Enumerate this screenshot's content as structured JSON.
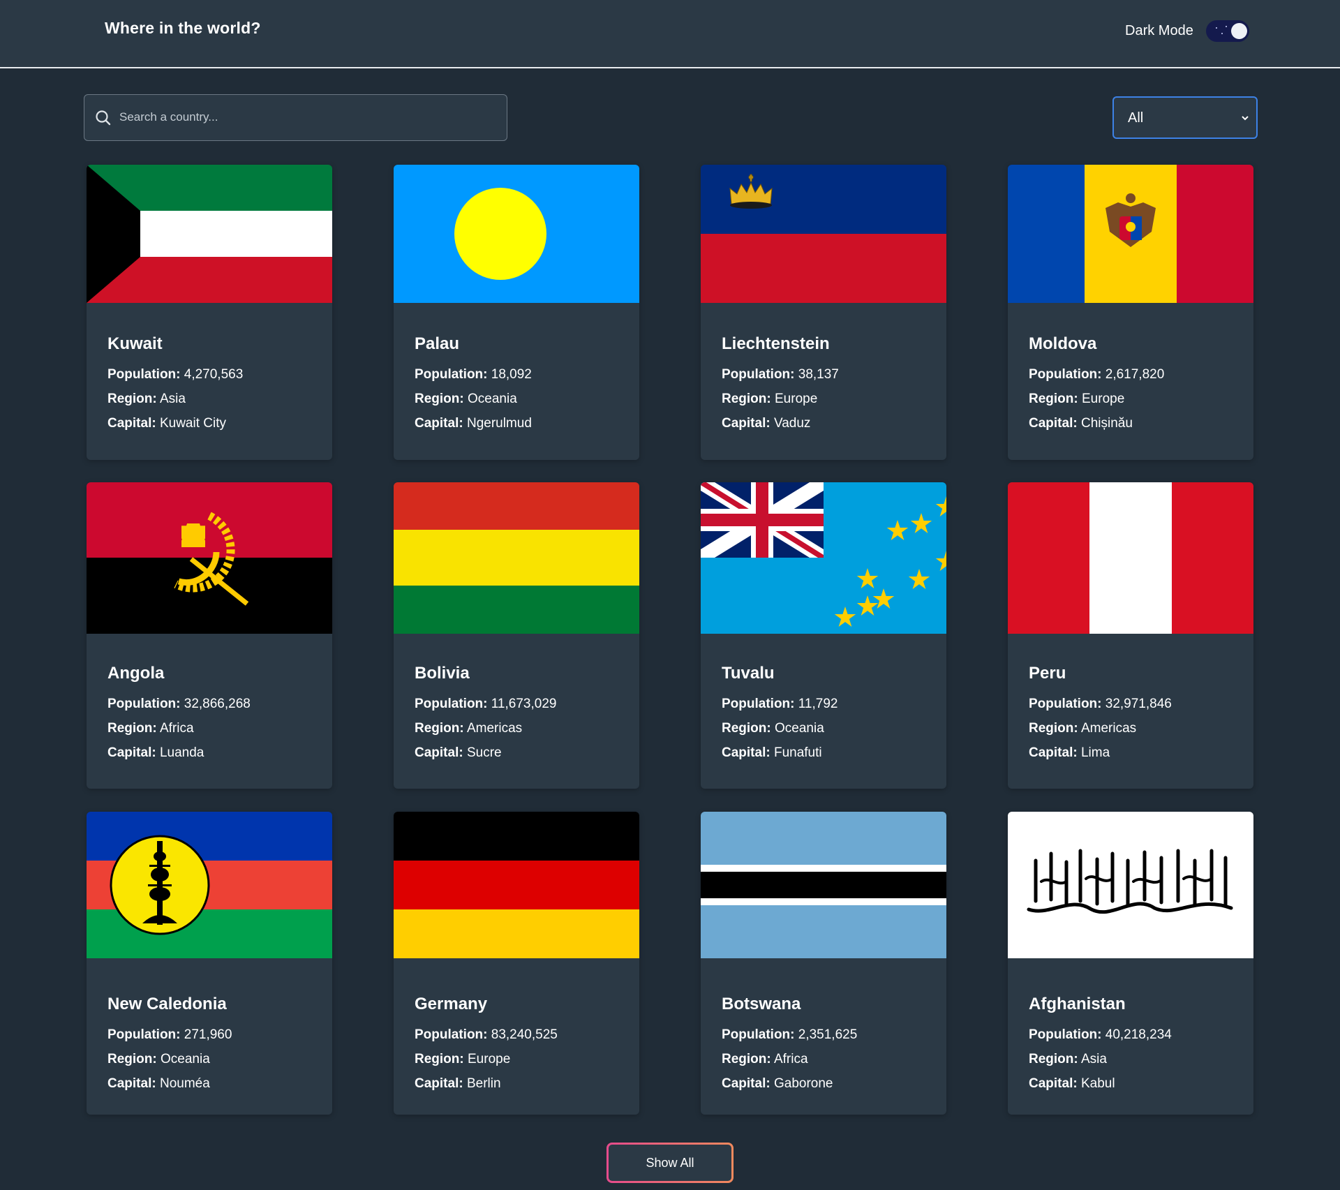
{
  "header": {
    "title": "Where in the world?",
    "mode_label": "Dark Mode"
  },
  "search": {
    "placeholder": "Search a country..."
  },
  "filter": {
    "selected": "All"
  },
  "labels": {
    "population": "Population:",
    "region": "Region:",
    "capital": "Capital:"
  },
  "countries": [
    {
      "name": "Kuwait",
      "population": "4,270,563",
      "region": "Asia",
      "capital": "Kuwait City"
    },
    {
      "name": "Palau",
      "population": "18,092",
      "region": "Oceania",
      "capital": "Ngerulmud"
    },
    {
      "name": "Liechtenstein",
      "population": "38,137",
      "region": "Europe",
      "capital": "Vaduz"
    },
    {
      "name": "Moldova",
      "population": "2,617,820",
      "region": "Europe",
      "capital": "Chișinău"
    },
    {
      "name": "Angola",
      "population": "32,866,268",
      "region": "Africa",
      "capital": "Luanda"
    },
    {
      "name": "Bolivia",
      "population": "11,673,029",
      "region": "Americas",
      "capital": "Sucre"
    },
    {
      "name": "Tuvalu",
      "population": "11,792",
      "region": "Oceania",
      "capital": "Funafuti"
    },
    {
      "name": "Peru",
      "population": "32,971,846",
      "region": "Americas",
      "capital": "Lima"
    },
    {
      "name": "New Caledonia",
      "population": "271,960",
      "region": "Oceania",
      "capital": "Nouméa"
    },
    {
      "name": "Germany",
      "population": "83,240,525",
      "region": "Europe",
      "capital": "Berlin"
    },
    {
      "name": "Botswana",
      "population": "2,351,625",
      "region": "Africa",
      "capital": "Gaborone"
    },
    {
      "name": "Afghanistan",
      "population": "40,218,234",
      "region": "Asia",
      "capital": "Kabul"
    }
  ],
  "show_all": "Show All",
  "colors": {
    "background": "#202c37",
    "surface": "#2b3945",
    "select_border": "#3d82e6",
    "toggle_track": "#141a4d"
  }
}
